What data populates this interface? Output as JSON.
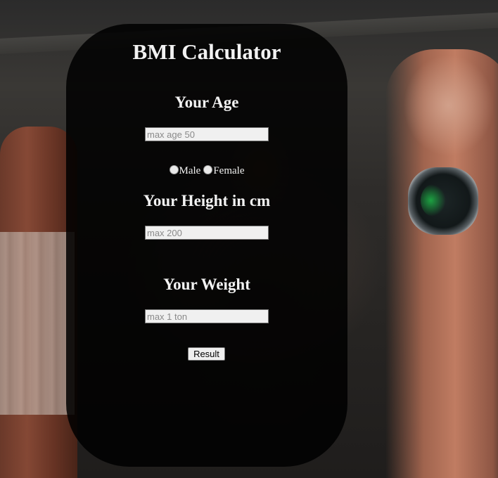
{
  "app": {
    "title": "BMI Calculator"
  },
  "age": {
    "heading": "Your Age",
    "placeholder": "max age 50",
    "value": ""
  },
  "gender": {
    "options": [
      "Male",
      "Female"
    ],
    "selected": null
  },
  "height": {
    "heading": "Your Height in cm",
    "placeholder": "max 200",
    "value": ""
  },
  "weight": {
    "heading": "Your Weight",
    "placeholder": "max 1 ton",
    "value": ""
  },
  "actions": {
    "result_label": "Result"
  },
  "colors": {
    "card_background": "#000000",
    "text": "#f2f2f2",
    "input_background": "#f0f0f0"
  }
}
